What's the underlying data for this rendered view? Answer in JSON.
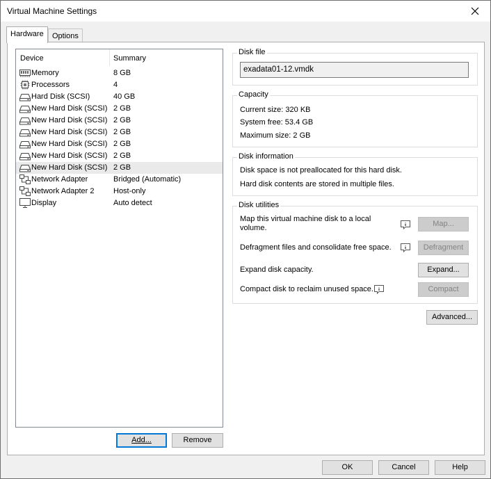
{
  "window": {
    "title": "Virtual Machine Settings"
  },
  "tabs": [
    {
      "label": "Hardware",
      "active": true
    },
    {
      "label": "Options",
      "active": false
    }
  ],
  "device_list": {
    "columns": [
      "Device",
      "Summary"
    ],
    "rows": [
      {
        "icon": "memory-icon",
        "device": "Memory",
        "summary": "8 GB"
      },
      {
        "icon": "processor-icon",
        "device": "Processors",
        "summary": "4"
      },
      {
        "icon": "hard-disk-icon",
        "device": "Hard Disk (SCSI)",
        "summary": "40 GB"
      },
      {
        "icon": "hard-disk-icon",
        "device": "New Hard Disk (SCSI)",
        "summary": "2 GB"
      },
      {
        "icon": "hard-disk-icon",
        "device": "New Hard Disk (SCSI)",
        "summary": "2 GB"
      },
      {
        "icon": "hard-disk-icon",
        "device": "New Hard Disk (SCSI)",
        "summary": "2 GB"
      },
      {
        "icon": "hard-disk-icon",
        "device": "New Hard Disk (SCSI)",
        "summary": "2 GB"
      },
      {
        "icon": "hard-disk-icon",
        "device": "New Hard Disk (SCSI)",
        "summary": "2 GB"
      },
      {
        "icon": "hard-disk-icon",
        "device": "New Hard Disk (SCSI)",
        "summary": "2 GB",
        "selected": true
      },
      {
        "icon": "network-adapter-icon",
        "device": "Network Adapter",
        "summary": "Bridged (Automatic)"
      },
      {
        "icon": "network-adapter-icon",
        "device": "Network Adapter 2",
        "summary": "Host-only"
      },
      {
        "icon": "display-icon",
        "device": "Display",
        "summary": "Auto detect"
      }
    ],
    "add_label": "Add...",
    "remove_label": "Remove"
  },
  "disk_file": {
    "label": "Disk file",
    "value": "exadata01-12.vmdk"
  },
  "capacity": {
    "label": "Capacity",
    "current_size": "Current size:  320 KB",
    "system_free": "System free:  53.4 GB",
    "maximum_size": "Maximum size:  2 GB"
  },
  "disk_information": {
    "label": "Disk information",
    "line1": "Disk space is not preallocated for this hard disk.",
    "line2": "Hard disk contents are stored in multiple files."
  },
  "disk_utilities": {
    "label": "Disk utilities",
    "map_text_1": "Map this virtual machine disk to a local",
    "map_text_2": "volume.",
    "map_button": "Map...",
    "defrag_text": "Defragment files and consolidate free space.",
    "defrag_button": "Defragment",
    "expand_text": "Expand disk capacity.",
    "expand_button": "Expand...",
    "compact_text": "Compact disk to reclaim unused space.",
    "compact_button": "Compact"
  },
  "advanced_label": "Advanced...",
  "footer": {
    "ok": "OK",
    "cancel": "Cancel",
    "help": "Help"
  }
}
